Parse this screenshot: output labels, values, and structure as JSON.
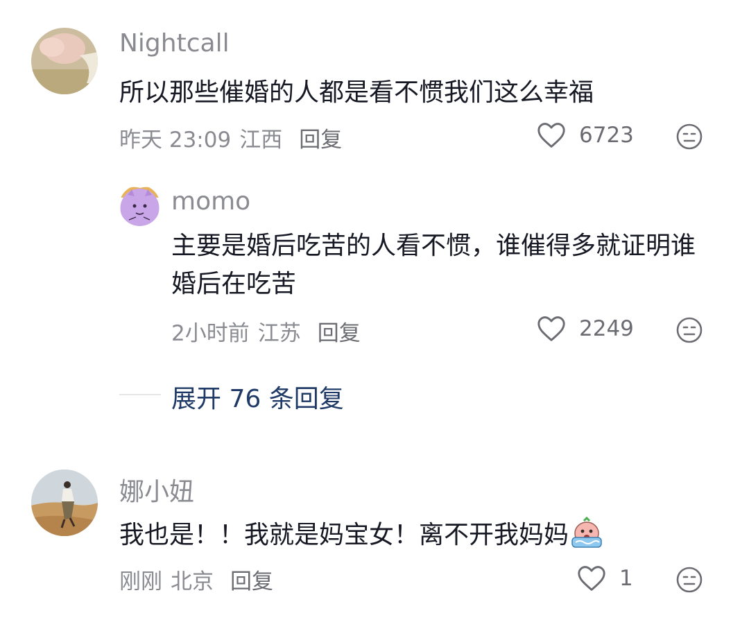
{
  "comments": [
    {
      "username": "Nightcall",
      "text": "所以那些催婚的人都是看不惯我们这么幸福",
      "time": "昨天 23:09",
      "location": "江西",
      "reply_label": "回复",
      "likes": "6723",
      "avatar_icon": "avatar-photo-icon"
    },
    {
      "username": "momo",
      "text": "主要是婚后吃苦的人看不惯，谁催得多就证明谁婚后在吃苦",
      "time": "2小时前",
      "location": "江苏",
      "reply_label": "回复",
      "likes": "2249",
      "avatar_icon": "purple-cartoon-avatar-icon"
    },
    {
      "username": "娜小妞",
      "text": "我也是！！我就是妈宝女！离不开我妈妈",
      "time": "刚刚",
      "location": "北京",
      "reply_label": "回复",
      "likes": "1",
      "avatar_icon": "desert-photo-avatar-icon"
    }
  ],
  "expand_replies": "展开 76 条回复",
  "colors": {
    "text": "#161823",
    "meta": "#8a8b91",
    "link": "#1f3a66",
    "momo_avatar": "#c9a6e8"
  }
}
